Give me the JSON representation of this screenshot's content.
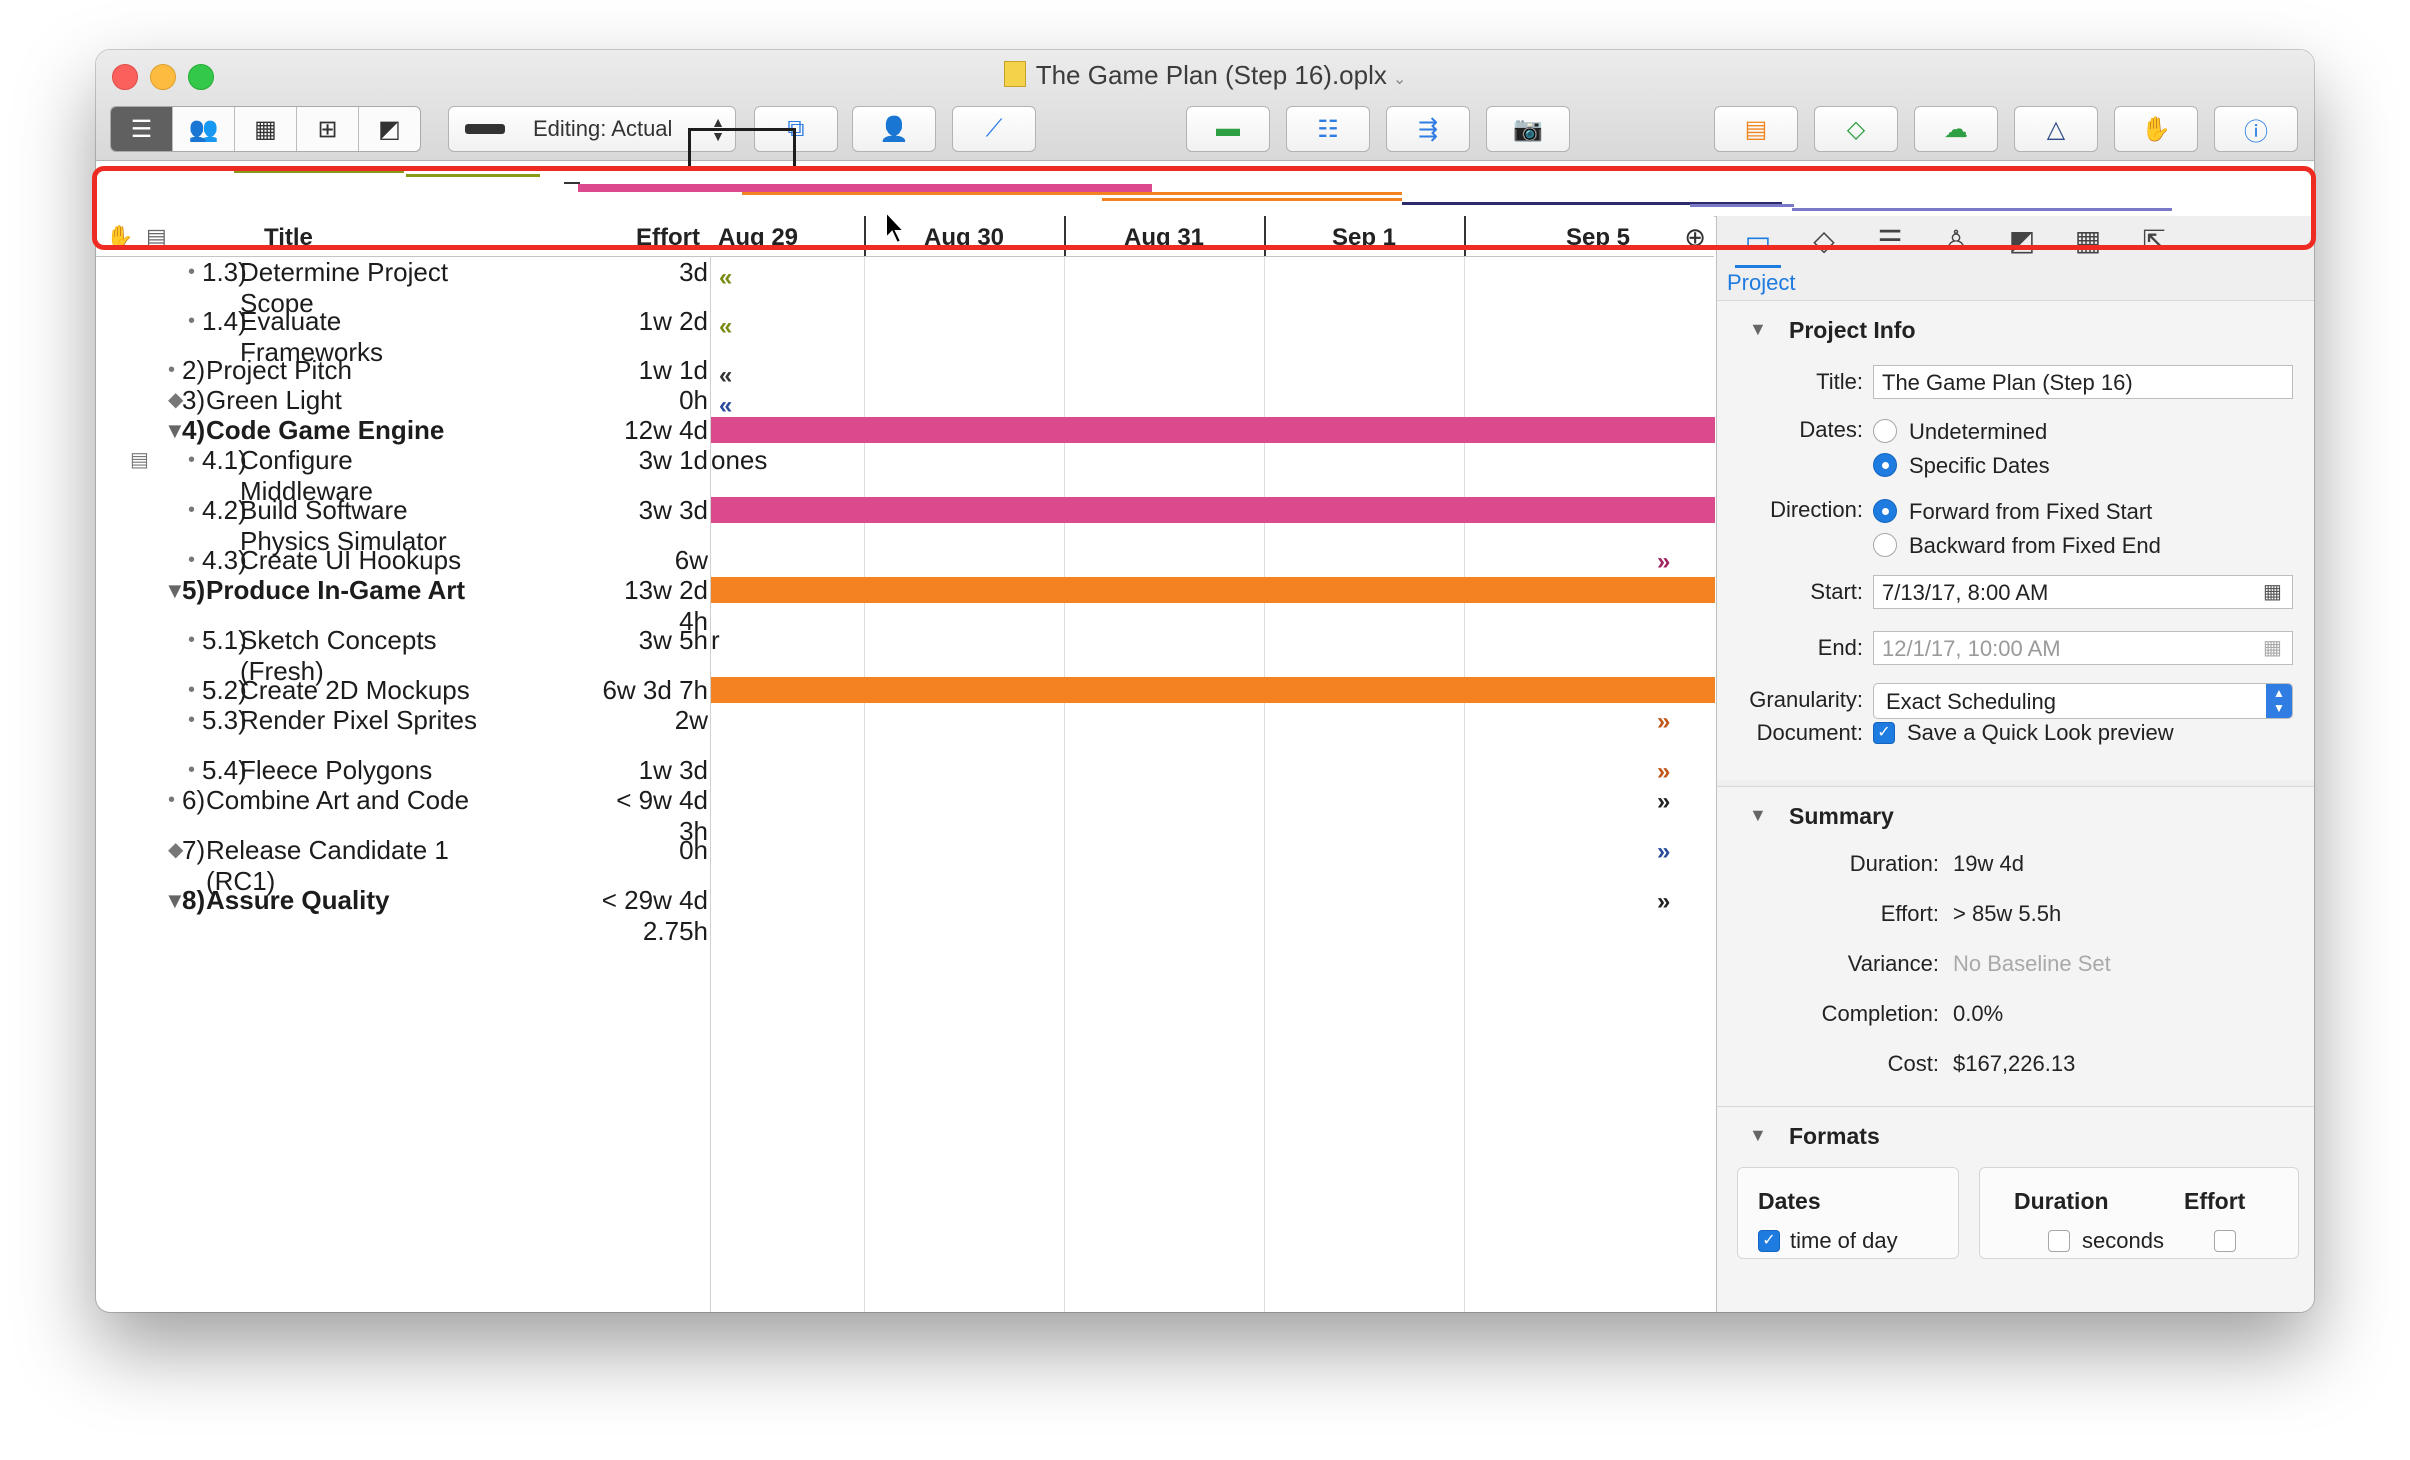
{
  "window": {
    "title": "The Game Plan (Step 16).oplx"
  },
  "toolbar": {
    "view_icons": [
      "gantt-view-icon",
      "resource-view-icon",
      "calendar-view-icon",
      "network-view-icon",
      "styles-view-icon"
    ],
    "editing_label": "Editing: Actual",
    "icons": [
      "connect-tasks-icon",
      "resource-assign-icon",
      "level-icon",
      "catch-up-icon",
      "split-task-icon",
      "reschedule-icon",
      "snapshot-icon",
      "spreadsheet-icon",
      "baseline-icon",
      "publish-icon",
      "warnings-icon",
      "violations-icon",
      "info-icon"
    ]
  },
  "columns": {
    "title": "Title",
    "effort": "Effort",
    "dates": [
      "Aug 29",
      "Aug 30",
      "Aug 31",
      "Sep 1",
      "Sep 5"
    ]
  },
  "rows": [
    {
      "num": "1.3)",
      "title": "Determine Project Scope",
      "effort": "3d",
      "kind": "bullet",
      "marker": "«",
      "marker_color": "#7a8a10"
    },
    {
      "num": "1.4)",
      "title": "Evaluate Frameworks",
      "effort": "1w 2d",
      "kind": "bullet",
      "marker": "«",
      "marker_color": "#7a8a10"
    },
    {
      "num": "2)",
      "title": "Project Pitch",
      "effort": "1w 1d",
      "kind": "bullet",
      "marker": "«",
      "marker_color": "#333333"
    },
    {
      "num": "3)",
      "title": "Green Light",
      "effort": "0h",
      "kind": "diamond",
      "marker": "«",
      "marker_color": "#2a4a9a"
    },
    {
      "num": "4)",
      "title": "Code Game Engine",
      "effort": "12w 4d",
      "kind": "group",
      "bar_color": "#dc4a8e"
    },
    {
      "num": "4.1)",
      "title": "Configure Middleware",
      "effort": "3w 1d",
      "kind": "bullet",
      "chart_text": "ones"
    },
    {
      "num": "4.2)",
      "title": "Build Software Physics Simulator",
      "effort": "3w 3d",
      "kind": "bullet",
      "bar_color": "#dc4a8e"
    },
    {
      "num": "4.3)",
      "title": "Create UI Hookups",
      "effort": "6w",
      "kind": "bullet",
      "marker": "»",
      "marker_color": "#a0245e"
    },
    {
      "num": "5)",
      "title": "Produce In-Game Art",
      "effort": "13w 2d",
      "effort2": "4h",
      "kind": "group",
      "bar_color": "#f58220"
    },
    {
      "num": "5.1)",
      "title": "Sketch Concepts (Fresh)",
      "effort": "3w 5h",
      "kind": "bullet",
      "chart_text": "r"
    },
    {
      "num": "5.2)",
      "title": "Create 2D Mockups",
      "effort": "6w 3d 7h",
      "kind": "bullet",
      "bar_color": "#f58220"
    },
    {
      "num": "5.3)",
      "title": "Render Pixel Sprites",
      "effort": "2w",
      "kind": "bullet",
      "marker": "»",
      "marker_color": "#c0561a"
    },
    {
      "num": "5.4)",
      "title": "Fleece Polygons",
      "effort": "1w 3d",
      "kind": "bullet",
      "marker": "»",
      "marker_color": "#c0561a"
    },
    {
      "num": "6)",
      "title": "Combine Art and Code",
      "effort": "< 9w 4d",
      "effort2": "3h",
      "kind": "bullet",
      "marker": "»",
      "marker_color": "#222222"
    },
    {
      "num": "7)",
      "title": "Release Candidate 1 (RC1)",
      "effort": "0h",
      "kind": "diamond",
      "marker": "»",
      "marker_color": "#2a4a9a"
    },
    {
      "num": "8)",
      "title": "Assure Quality",
      "effort": "< 29w 4d",
      "effort2": "2.75h",
      "kind": "group",
      "marker": "»",
      "marker_color": "#222222"
    }
  ],
  "inspector": {
    "tab_icons": [
      "project-icon",
      "milestone-icon",
      "task-icon",
      "resource-icon",
      "style-icon",
      "table-icon",
      "export-icon"
    ],
    "tab_label": "Project",
    "project_info": {
      "heading": "Project Info",
      "title_label": "Title:",
      "title_value": "The Game Plan (Step 16)",
      "dates_label": "Dates:",
      "dates_options": [
        "Undetermined",
        "Specific Dates"
      ],
      "dates_selected": "Specific Dates",
      "direction_label": "Direction:",
      "direction_options": [
        "Forward from Fixed Start",
        "Backward from Fixed End"
      ],
      "direction_selected": "Forward from Fixed Start",
      "start_label": "Start:",
      "start_value": "7/13/17, 8:00 AM",
      "end_label": "End:",
      "end_value": "12/1/17, 10:00 AM",
      "granularity_label": "Granularity:",
      "granularity_value": "Exact Scheduling",
      "document_label": "Document:",
      "document_check": "Save a Quick Look preview"
    },
    "summary": {
      "heading": "Summary",
      "duration_label": "Duration:",
      "duration": "19w 4d",
      "effort_label": "Effort:",
      "effort": "> 85w 5.5h",
      "variance_label": "Variance:",
      "variance": "No Baseline Set",
      "completion_label": "Completion:",
      "completion": "0.0%",
      "cost_label": "Cost:",
      "cost": "$167,226.13"
    },
    "formats": {
      "heading": "Formats",
      "dates_head": "Dates",
      "dates_opt": "time of day",
      "duration_head": "Duration",
      "duration_opt": "seconds",
      "effort_head": "Effort"
    }
  },
  "colors": {
    "accent": "#1e7be0",
    "callout": "#ee2b22",
    "pink": "#dc4a8e",
    "orange": "#f58220"
  }
}
